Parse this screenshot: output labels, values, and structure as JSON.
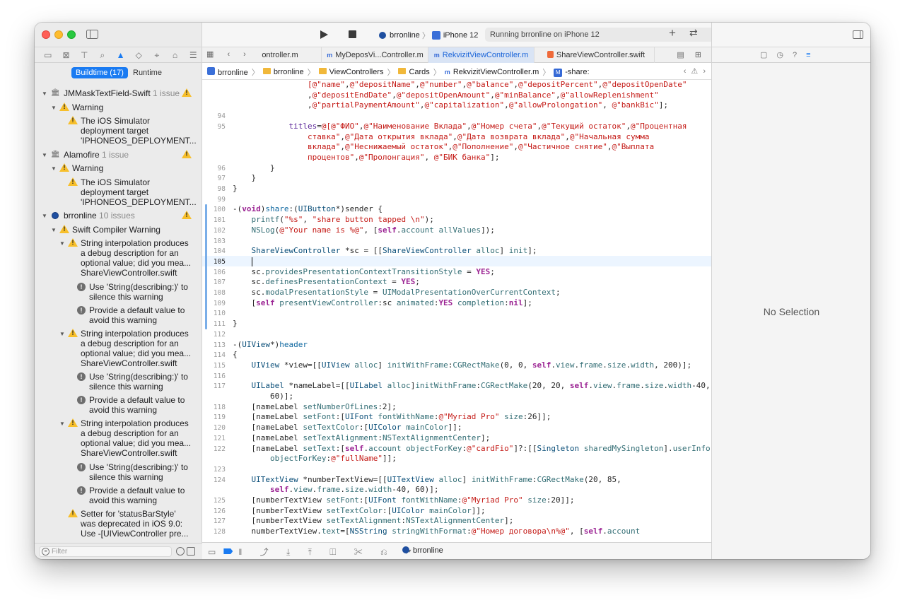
{
  "navigator": {
    "icons": [
      "folder-icon",
      "x-square-icon",
      "hierarchy-icon",
      "search-icon",
      "warning-icon",
      "diamond-icon",
      "spray-icon",
      "tag-icon",
      "list-icon"
    ],
    "segment": {
      "active": "Buildtime (17)",
      "inactive": "Runtime"
    },
    "filter_placeholder": "Filter",
    "rows": [
      {
        "kind": "group",
        "text": "JMMaskTextField-Swift",
        "count": "1 issue"
      },
      {
        "kind": "category",
        "text": "Warning"
      },
      {
        "kind": "warning",
        "lines": [
          "The iOS Simulator",
          "deployment target",
          "'IPHONEOS_DEPLOYMENT..."
        ]
      },
      {
        "kind": "group",
        "text": "Alamofire",
        "count": "1 issue"
      },
      {
        "kind": "category",
        "text": "Warning"
      },
      {
        "kind": "warning",
        "lines": [
          "The iOS Simulator",
          "deployment target",
          "'IPHONEOS_DEPLOYMENT..."
        ]
      },
      {
        "kind": "project",
        "text": "brronline",
        "count": "10 issues"
      },
      {
        "kind": "category",
        "text": "Swift Compiler Warning"
      },
      {
        "kind": "issue",
        "lines": [
          "String interpolation produces",
          "a debug description for an",
          "optional value; did you mea..."
        ],
        "file": "ShareViewController.swift"
      },
      {
        "kind": "fixit",
        "lines": [
          "Use 'String(describing:)' to",
          "silence this warning"
        ]
      },
      {
        "kind": "fixit",
        "lines": [
          "Provide a default value to",
          "avoid this warning"
        ]
      },
      {
        "kind": "issue",
        "lines": [
          "String interpolation produces",
          "a debug description for an",
          "optional value; did you mea..."
        ],
        "file": "ShareViewController.swift"
      },
      {
        "kind": "fixit",
        "lines": [
          "Use 'String(describing:)' to",
          "silence this warning"
        ]
      },
      {
        "kind": "fixit",
        "lines": [
          "Provide a default value to",
          "avoid this warning"
        ]
      },
      {
        "kind": "issue",
        "lines": [
          "String interpolation produces",
          "a debug description for an",
          "optional value; did you mea..."
        ],
        "file": "ShareViewController.swift"
      },
      {
        "kind": "fixit",
        "lines": [
          "Use 'String(describing:)' to",
          "silence this warning"
        ]
      },
      {
        "kind": "fixit",
        "lines": [
          "Provide a default value to",
          "avoid this warning"
        ]
      },
      {
        "kind": "warning",
        "lines": [
          "Setter for 'statusBarStyle'",
          "was deprecated in iOS 9.0:",
          "Use -[UIViewController pre..."
        ]
      }
    ]
  },
  "toolbar": {
    "scheme": "brronline",
    "device": "iPhone 12",
    "activity": "Running brronline on iPhone 12",
    "warning_count": "17"
  },
  "tabs": [
    {
      "label": "ontroller.m",
      "active": false,
      "kind": "m"
    },
    {
      "label": "MyDeposVi...Controller.m",
      "active": false,
      "kind": "m"
    },
    {
      "label": "RekvizitViewController.m",
      "active": true,
      "kind": "m"
    },
    {
      "label": "ShareViewController.swift",
      "active": false,
      "kind": "swift"
    }
  ],
  "jumpbar": [
    "brronline",
    "brronline",
    "ViewControllers",
    "Cards",
    "RekvizitViewController.m",
    "-share:"
  ],
  "code": {
    "current_line": 105,
    "lines": [
      {
        "n": "",
        "html": "                <span class=\"st\">[@\"name\"</span>,<span class=\"st\">@\"depositName\"</span>,<span class=\"st\">@\"number\"</span>,<span class=\"st\">@\"balance\"</span>,<span class=\"st\">@\"depositPercent\"</span>,<span class=\"st\">@\"depositOpenDate\"</span>"
      },
      {
        "n": "",
        "html": "                ,<span class=\"st\">@\"depositEndDate\"</span>,<span class=\"st\">@\"depositOpenAmount\"</span>,<span class=\"st\">@\"minBalance\"</span>,<span class=\"st\">@\"allowReplenishment\"</span>"
      },
      {
        "n": "",
        "html": "                ,<span class=\"st\">@\"partialPaymentAmount\"</span>,<span class=\"st\">@\"capitalization\"</span>,<span class=\"st\">@\"allowProlongation\"</span>, <span class=\"st\">@\"bankBic\"</span>];"
      },
      {
        "n": "94",
        "html": ""
      },
      {
        "n": "95",
        "html": "            <span class=\"pr\">titles</span>=<span class=\"st\">@[@\"ФИО\"</span>,<span class=\"st\">@\"Наименование Вклада\"</span>,<span class=\"st\">@\"Номер счета\"</span>,<span class=\"st\">@\"Текущий остаток\"</span>,<span class=\"st\">@\"Процентная</span>"
      },
      {
        "n": "",
        "html": "<span class=\"st\">                ставка\"</span>,<span class=\"st\">@\"Дата открытия вклада\"</span>,<span class=\"st\">@\"Дата возврата вклада\"</span>,<span class=\"st\">@\"Начальная сумма</span>"
      },
      {
        "n": "",
        "html": "<span class=\"st\">                вклада\"</span>,<span class=\"st\">@\"Неснижаемый остаток\"</span>,<span class=\"st\">@\"Пополнение\"</span>,<span class=\"st\">@\"Частичное снятие\"</span>,<span class=\"st\">@\"Выплата</span>"
      },
      {
        "n": "",
        "html": "<span class=\"st\">                процентов\"</span>,<span class=\"st\">@\"Пролонгация\"</span>, <span class=\"st\">@\"БИК банка\"</span>];"
      },
      {
        "n": "96",
        "html": "        }"
      },
      {
        "n": "97",
        "html": "    }"
      },
      {
        "n": "98",
        "html": "}"
      },
      {
        "n": "99",
        "html": ""
      },
      {
        "n": "100",
        "html": "-(<span class=\"kw\">void</span>)<span class=\"fn\">share</span>:(<span class=\"ty\">UIButton</span>*)sender {"
      },
      {
        "n": "101",
        "html": "    <span class=\"mt\">printf</span>(<span class=\"st\">\"%s\"</span>, <span class=\"st\">\"share button tapped \\n\"</span>);"
      },
      {
        "n": "102",
        "html": "    <span class=\"mt\">NSLog</span>(<span class=\"st\">@\"Your name is %@\"</span>, [<span class=\"kw\">self</span>.<span class=\"mt\">account</span> <span class=\"mt\">allValues</span>]);"
      },
      {
        "n": "103",
        "html": ""
      },
      {
        "n": "104",
        "html": "    <span class=\"ty\">ShareViewController</span> *sc = [[<span class=\"ty\">ShareViewController</span> <span class=\"mt\">alloc</span>] <span class=\"mt\">init</span>];"
      },
      {
        "n": "105",
        "html": ""
      },
      {
        "n": "106",
        "html": "    sc.<span class=\"mt\">providesPresentationContextTransitionStyle</span> = <span class=\"kw\">YES</span>;"
      },
      {
        "n": "107",
        "html": "    sc.<span class=\"mt\">definesPresentationContext</span> = <span class=\"kw\">YES</span>;"
      },
      {
        "n": "108",
        "html": "    sc.<span class=\"mt\">modalPresentationStyle</span> = <span class=\"mt\">UIModalPresentationOverCurrentContext</span>;"
      },
      {
        "n": "109",
        "html": "    [<span class=\"kw\">self</span> <span class=\"mt\">presentViewController</span>:sc <span class=\"mt\">animated</span>:<span class=\"kw\">YES</span> <span class=\"mt\">completion</span>:<span class=\"kw\">nil</span>];"
      },
      {
        "n": "110",
        "html": ""
      },
      {
        "n": "111",
        "html": "}"
      },
      {
        "n": "112",
        "html": ""
      },
      {
        "n": "113",
        "html": "-(<span class=\"ty\">UIView</span>*)<span class=\"fn\">header</span>"
      },
      {
        "n": "114",
        "html": "{"
      },
      {
        "n": "115",
        "html": "    <span class=\"ty\">UIView</span> *view=[[<span class=\"ty\">UIView</span> <span class=\"mt\">alloc</span>] <span class=\"mt\">initWithFrame</span>:<span class=\"mt\">CGRectMake</span>(0, 0, <span class=\"kw\">self</span>.<span class=\"mt\">view</span>.<span class=\"mt\">frame</span>.<span class=\"mt\">size</span>.<span class=\"mt\">width</span>, 200)];"
      },
      {
        "n": "116",
        "html": ""
      },
      {
        "n": "117",
        "html": "    <span class=\"ty\">UILabel</span> *nameLabel=[[<span class=\"ty\">UILabel</span> <span class=\"mt\">alloc</span>]<span class=\"mt\">initWithFrame</span>:<span class=\"mt\">CGRectMake</span>(20, 20, <span class=\"kw\">self</span>.<span class=\"mt\">view</span>.<span class=\"mt\">frame</span>.<span class=\"mt\">size</span>.<span class=\"mt\">width</span>-40,"
      },
      {
        "n": "",
        "html": "        60)];"
      },
      {
        "n": "118",
        "html": "    [nameLabel <span class=\"mt\">setNumberOfLines</span>:2];"
      },
      {
        "n": "119",
        "html": "    [nameLabel <span class=\"mt\">setFont</span>:[<span class=\"ty\">UIFont</span> <span class=\"mt\">fontWithName</span>:<span class=\"st\">@\"Myriad Pro\"</span> <span class=\"mt\">size</span>:26]];"
      },
      {
        "n": "120",
        "html": "    [nameLabel <span class=\"mt\">setTextColor</span>:[<span class=\"ty\">UIColor</span> <span class=\"mt\">mainColor</span>]];"
      },
      {
        "n": "121",
        "html": "    [nameLabel <span class=\"mt\">setTextAlignment</span>:<span class=\"mt\">NSTextAlignmentCenter</span>];"
      },
      {
        "n": "122",
        "html": "    [nameLabel <span class=\"mt\">setText</span>:[<span class=\"kw\">self</span>.<span class=\"mt\">account</span> <span class=\"mt\">objectForKey</span>:<span class=\"st\">@\"cardFio\"</span>]?:[[<span class=\"ty\">Singleton</span> <span class=\"mt\">sharedMySingleton</span>].<span class=\"mt\">userInfo</span>"
      },
      {
        "n": "",
        "html": "        <span class=\"mt\">objectForKey</span>:<span class=\"st\">@\"fullName\"</span>]];"
      },
      {
        "n": "123",
        "html": ""
      },
      {
        "n": "124",
        "html": "    <span class=\"ty\">UITextView</span> *numberTextView=[[<span class=\"ty\">UITextView</span> <span class=\"mt\">alloc</span>] <span class=\"mt\">initWithFrame</span>:<span class=\"mt\">CGRectMake</span>(20, 85,"
      },
      {
        "n": "",
        "html": "        <span class=\"kw\">self</span>.<span class=\"mt\">view</span>.<span class=\"mt\">frame</span>.<span class=\"mt\">size</span>.<span class=\"mt\">width</span>-40, 60)];"
      },
      {
        "n": "125",
        "html": "    [numberTextView <span class=\"mt\">setFont</span>:[<span class=\"ty\">UIFont</span> <span class=\"mt\">fontWithName</span>:<span class=\"st\">@\"Myriad Pro\"</span> <span class=\"mt\">size</span>:20]];"
      },
      {
        "n": "126",
        "html": "    [numberTextView <span class=\"mt\">setTextColor</span>:[<span class=\"ty\">UIColor</span> <span class=\"mt\">mainColor</span>]];"
      },
      {
        "n": "127",
        "html": "    [numberTextView <span class=\"mt\">setTextAlignment</span>:<span class=\"mt\">NSTextAlignmentCenter</span>];"
      },
      {
        "n": "128",
        "html": "    numberTextView.<span class=\"mt\">text</span>=[<span class=\"ty\">NSString</span> <span class=\"mt\">stringWithFormat</span>:<span class=\"st\">@\"Номер договора\\n%@\"</span>, [<span class=\"kw\">self</span>.<span class=\"mt\">account</span>"
      }
    ]
  },
  "debugbar": {
    "target": "brronline"
  },
  "inspector": {
    "empty": "No Selection"
  },
  "colors": {
    "accent": "#1a7bf2",
    "warning": "#f7bf2b",
    "string": "#c41a16",
    "keyword": "#9b2393"
  }
}
